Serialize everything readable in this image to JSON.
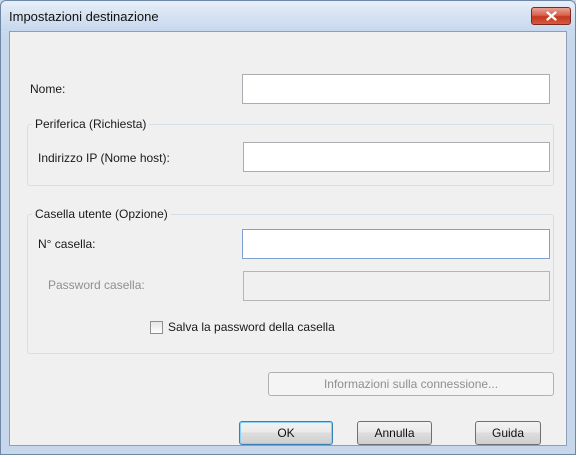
{
  "window": {
    "title": "Impostazioni destinazione"
  },
  "form": {
    "name_label": "Nome:",
    "name_value": "",
    "device_group": {
      "legend": "Periferica (Richiesta)",
      "ip_label": "Indirizzo IP (Nome host):",
      "ip_value": ""
    },
    "mailbox_group": {
      "legend": "Casella utente (Opzione)",
      "box_number_label": "N° casella:",
      "box_number_value": "",
      "password_label": "Password casella:",
      "password_value": "",
      "save_password_label": "Salva la password della casella",
      "save_password_checked": false
    }
  },
  "buttons": {
    "connection_info": "Informazioni sulla connessione...",
    "ok": "OK",
    "cancel": "Annulla",
    "help": "Guida"
  },
  "icons": {
    "close": "close-icon"
  },
  "colors": {
    "close_button": "#c4371f",
    "default_button_border": "#3c7fb1"
  }
}
